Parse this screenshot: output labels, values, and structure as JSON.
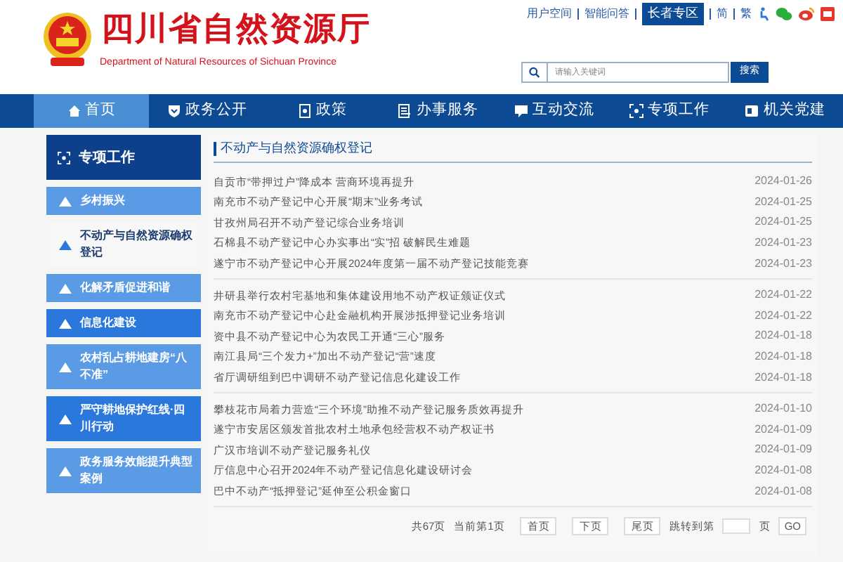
{
  "top_links": [
    {
      "label": "用户空间",
      "highlight": false
    },
    {
      "label": "智能问答",
      "highlight": false
    },
    {
      "label": "长者专区",
      "highlight": true
    },
    {
      "label": "简",
      "highlight": false
    },
    {
      "label": "繁",
      "highlight": false
    }
  ],
  "site": {
    "title": "四川省自然资源厅",
    "subtitle": "Department of Natural Resources of Sichuan Province"
  },
  "search": {
    "placeholder": "请输入关键词",
    "button": "搜索"
  },
  "nav": [
    {
      "label": "首页",
      "selected": true
    },
    {
      "label": "政务公开",
      "selected": false
    },
    {
      "label": "政策",
      "selected": false
    },
    {
      "label": "办事服务",
      "selected": false
    },
    {
      "label": "互动交流",
      "selected": false
    },
    {
      "label": "专项工作",
      "selected": false
    },
    {
      "label": "机关党建",
      "selected": false
    }
  ],
  "sidebar": {
    "title": "专项工作",
    "items": [
      {
        "label": "乡村振兴",
        "selected": false,
        "color": "#5b9be6"
      },
      {
        "label": "不动产与自然资源确权登记",
        "selected": true
      },
      {
        "label": "化解矛盾促进和谐",
        "selected": false,
        "color": "#5b9be6"
      },
      {
        "label": "信息化建设",
        "selected": false,
        "color": "#2a78dc"
      },
      {
        "label": "农村乱占耕地建房“八不准”",
        "selected": false,
        "color": "#5b9be6"
      },
      {
        "label": "严守耕地保护红线·四川行动",
        "selected": false,
        "color": "#2a78dc"
      },
      {
        "label": "政务服务效能提升典型案例",
        "selected": false,
        "color": "#5b9be6"
      }
    ]
  },
  "section": {
    "title": "不动产与自然资源确权登记",
    "groups": [
      [
        {
          "title": "自贡市“带押过户”降成本 营商环境再提升",
          "date": "2024-01-26"
        },
        {
          "title": "南充市不动产登记中心开展“期末”业务考试",
          "date": "2024-01-25"
        },
        {
          "title": "甘孜州局召开不动产登记综合业务培训",
          "date": "2024-01-25"
        },
        {
          "title": "石棉县不动产登记中心办实事出“实”招 破解民生难题",
          "date": "2024-01-23"
        },
        {
          "title": "遂宁市不动产登记中心开展2024年度第一届不动产登记技能竞赛",
          "date": "2024-01-23"
        }
      ],
      [
        {
          "title": "井研县举行农村宅基地和集体建设用地不动产权证颁证仪式",
          "date": "2024-01-22"
        },
        {
          "title": "南充市不动产登记中心赴金融机构开展涉抵押登记业务培训",
          "date": "2024-01-22"
        },
        {
          "title": "资中县不动产登记中心为农民工开通“三心”服务",
          "date": "2024-01-18"
        },
        {
          "title": "南江县局“三个发力+”加出不动产登记“营”速度",
          "date": "2024-01-18"
        },
        {
          "title": "省厅调研组到巴中调研不动产登记信息化建设工作",
          "date": "2024-01-18"
        }
      ],
      [
        {
          "title": "攀枝花市局着力营造“三个环境”助推不动产登记服务质效再提升",
          "date": "2024-01-10"
        },
        {
          "title": "遂宁市安居区颁发首批农村土地承包经营权不动产权证书",
          "date": "2024-01-09"
        },
        {
          "title": "广汉市培训不动产登记服务礼仪",
          "date": "2024-01-09"
        },
        {
          "title": "厅信息中心召开2024年不动产登记信息化建设研讨会",
          "date": "2024-01-08"
        },
        {
          "title": "巴中不动产“抵押登记”延伸至公积金窗口",
          "date": "2024-01-08"
        }
      ]
    ]
  },
  "pagination": {
    "total": "共67页",
    "current": "当前第1页",
    "buttons": [
      "首页",
      "下页",
      "尾页"
    ],
    "jump_before": "跳转到第",
    "jump_after": "页",
    "go": "GO"
  }
}
